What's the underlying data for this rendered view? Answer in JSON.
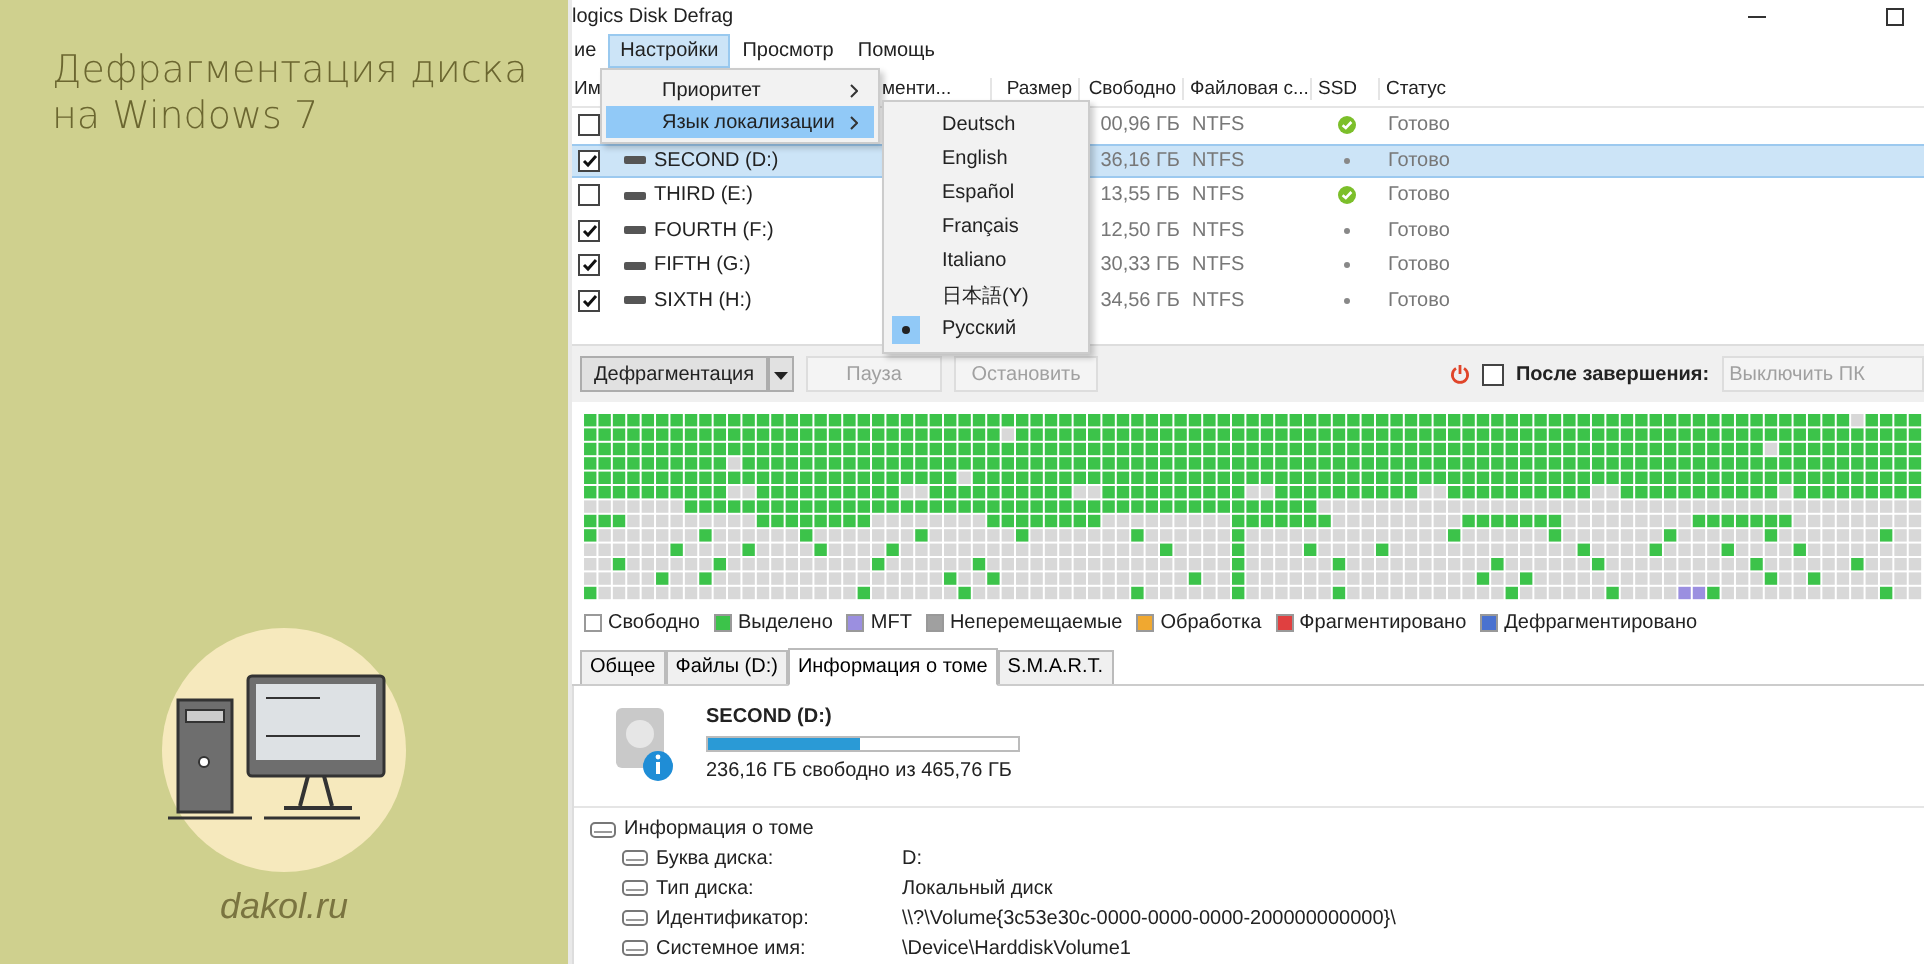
{
  "promo": {
    "title": "Дефрагментация диска на Windows 7",
    "site": "dakol.ru"
  },
  "window": {
    "title": "logics Disk Defrag"
  },
  "menu": [
    {
      "label": "ие",
      "selected": false
    },
    {
      "label": "Настройки",
      "selected": true
    },
    {
      "label": "Просмотр",
      "selected": false
    },
    {
      "label": "Помощь",
      "selected": false
    }
  ],
  "settings_menu": [
    {
      "label": "Приоритет",
      "selected": false
    },
    {
      "label": "Язык локализации",
      "selected": true
    }
  ],
  "language_menu": [
    {
      "label": "Deutsch",
      "selected": false
    },
    {
      "label": "English",
      "selected": false
    },
    {
      "label": "Español",
      "selected": false
    },
    {
      "label": "Français",
      "selected": false
    },
    {
      "label": "Italiano",
      "selected": false
    },
    {
      "label": "日本語(Y)",
      "selected": false
    },
    {
      "label": "Русский",
      "selected": true
    }
  ],
  "drives": {
    "columns": [
      "Им",
      "менти...",
      "Размер",
      "Свободно",
      "Файловая с...",
      "SSD",
      "Статус"
    ],
    "rows": [
      {
        "checked": false,
        "selected": false,
        "free": "00,96 ГБ",
        "fs": "NTFS",
        "ssd": true,
        "status": "Готово"
      },
      {
        "checked": true,
        "selected": true,
        "name": "SECOND (D:)",
        "free": "36,16 ГБ",
        "fs": "NTFS",
        "ssd": false,
        "status": "Готово"
      },
      {
        "checked": false,
        "selected": false,
        "name": "THIRD (E:)",
        "free": "13,55 ГБ",
        "fs": "NTFS",
        "ssd": true,
        "status": "Готово"
      },
      {
        "checked": true,
        "selected": false,
        "name": "FOURTH (F:)",
        "free": "12,50 ГБ",
        "fs": "NTFS",
        "ssd": false,
        "status": "Готово"
      },
      {
        "checked": true,
        "selected": false,
        "name": "FIFTH (G:)",
        "free": "30,33 ГБ",
        "fs": "NTFS",
        "ssd": false,
        "status": "Готово"
      },
      {
        "checked": true,
        "selected": false,
        "name": "SIXTH (H:)",
        "free": "34,56 ГБ",
        "fs": "NTFS",
        "ssd": false,
        "status": "Готово"
      }
    ]
  },
  "toolbar": {
    "defrag": "Дефрагментация",
    "pause": {
      "label": "Пауза",
      "disabled": true
    },
    "stop": {
      "label": "Остановить",
      "disabled": true
    },
    "after": {
      "label": "После завершения:",
      "checked": false,
      "value": "Выключить ПК",
      "disabled": true
    }
  },
  "legend": [
    {
      "label": "Свободно",
      "color": "#ffffff"
    },
    {
      "label": "Выделено",
      "color": "#3cc34a"
    },
    {
      "label": "MFT",
      "color": "#9b8fe0"
    },
    {
      "label": "Неперемещаемые",
      "color": "#a0a0a0"
    },
    {
      "label": "Обработка",
      "color": "#f0a830"
    },
    {
      "label": "Фрагментировано",
      "color": "#e04040"
    },
    {
      "label": "Дефрагментировано",
      "color": "#4a72d0"
    }
  ],
  "tabs": [
    {
      "label": "Общее",
      "selected": false
    },
    {
      "label": "Файлы (D:)",
      "selected": false
    },
    {
      "label": "Информация о томе",
      "selected": true
    },
    {
      "label": "S.M.A.R.T.",
      "selected": false
    }
  ],
  "volume": {
    "name": "SECOND (D:)",
    "level": 0.49,
    "summary": "236,16 ГБ свободно из 465,76 ГБ",
    "info": {
      "label": "Информация о томе",
      "children": [
        {
          "label": "Буква диска:",
          "value": "D:"
        },
        {
          "label": "Тип диска:",
          "value": "Локальный диск"
        },
        {
          "label": "Идентификатор:",
          "value": "\\\\?\\Volume{3c53e30c-0000-0000-0000-200000000000}\\"
        },
        {
          "label": "Системное имя:",
          "value": "\\Device\\HarddiskVolume1"
        }
      ]
    }
  }
}
